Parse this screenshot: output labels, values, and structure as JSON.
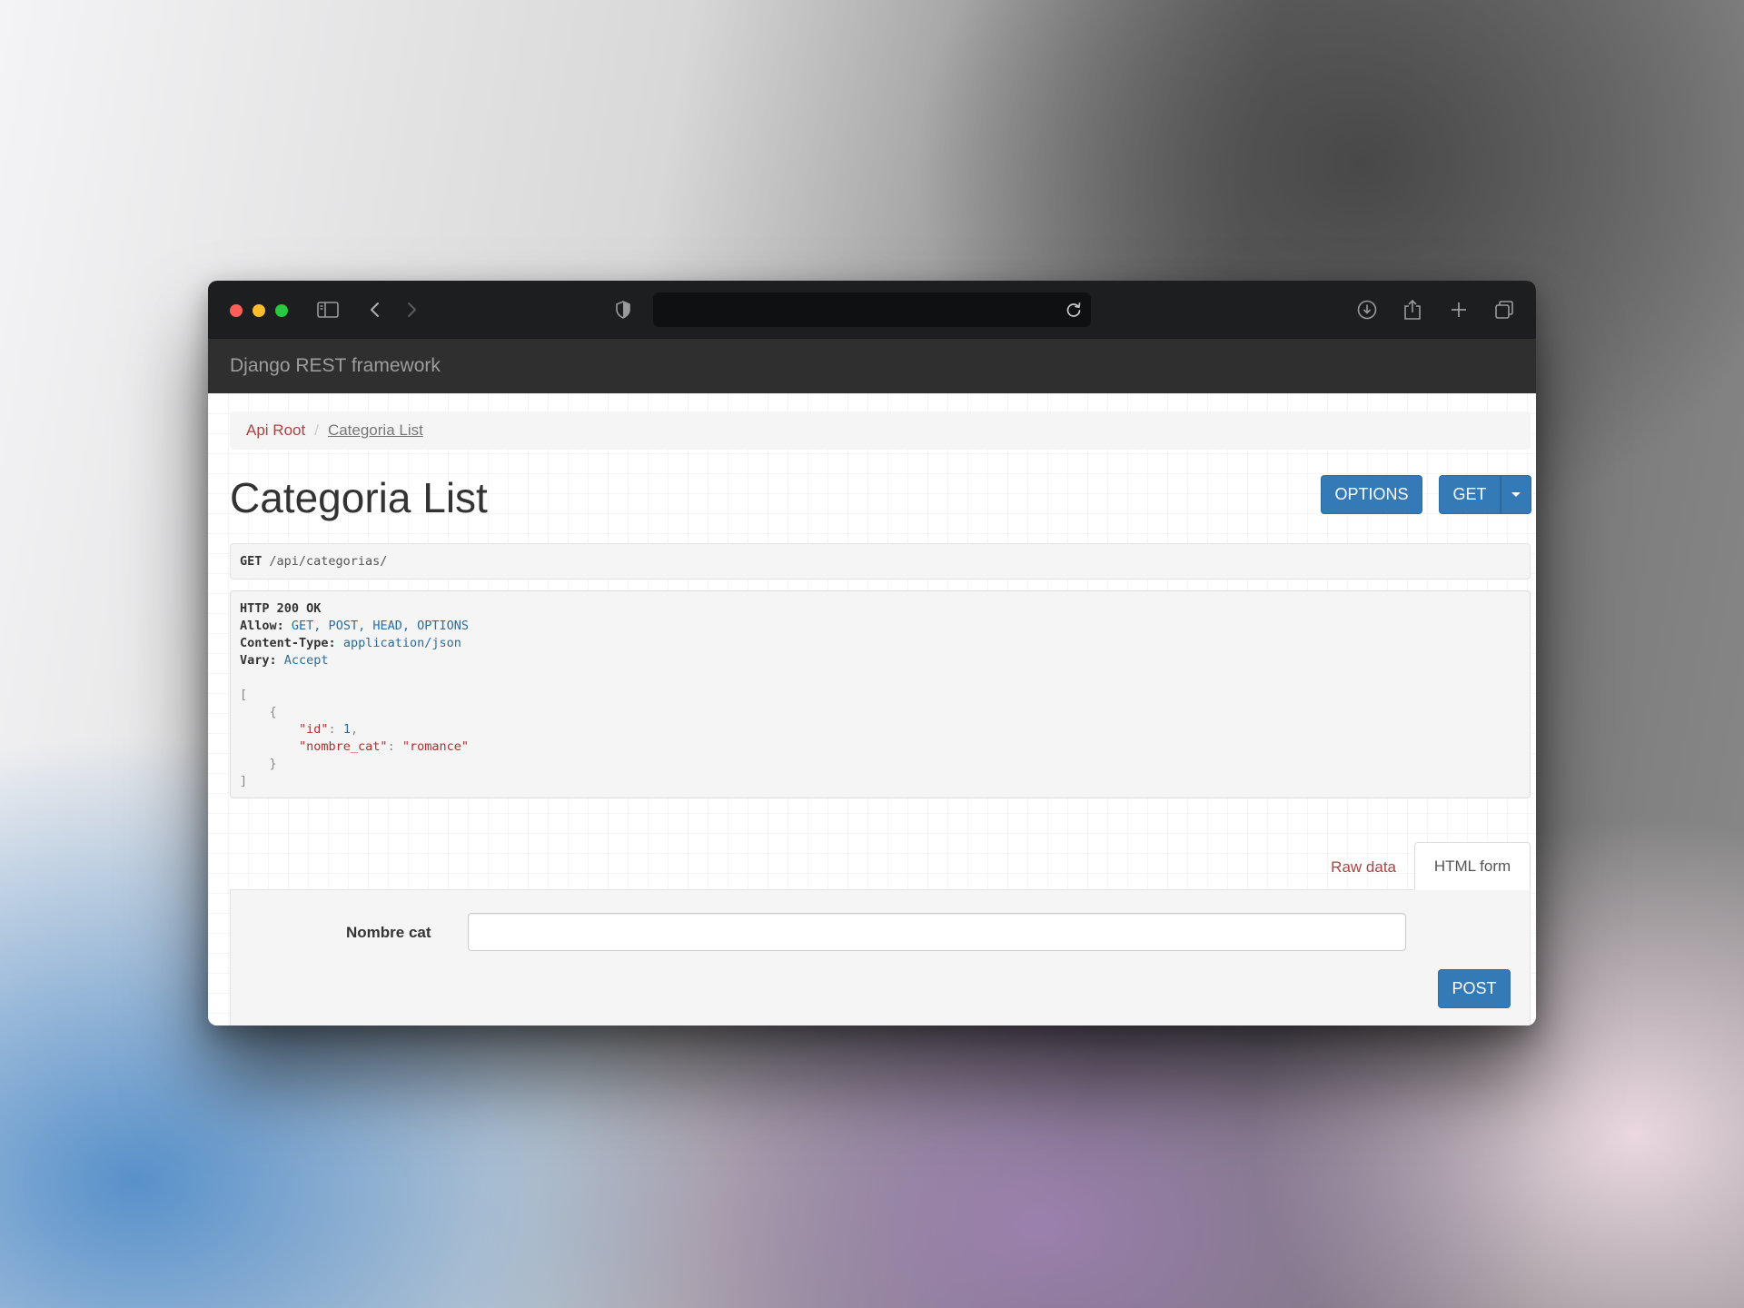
{
  "browser": {
    "url": "",
    "icons": {
      "sidebar": "sidebar-icon",
      "back": "chevron-left-icon",
      "forward": "chevron-right-icon",
      "shield": "shield-icon",
      "reload": "reload-icon",
      "download": "download-icon",
      "share": "share-icon",
      "new_tab": "plus-icon",
      "tabs": "tabs-overview-icon"
    }
  },
  "navbar": {
    "brand": "Django REST framework"
  },
  "breadcrumb": {
    "root": "Api Root",
    "separator": "/",
    "current": "Categoria List"
  },
  "page": {
    "title": "Categoria List"
  },
  "actions": {
    "options_label": "OPTIONS",
    "get_label": "GET"
  },
  "request": {
    "method": "GET",
    "path": "/api/categorias/"
  },
  "response": {
    "status": "HTTP 200 OK",
    "headers": [
      {
        "name": "Allow:",
        "value": "GET, POST, HEAD, OPTIONS"
      },
      {
        "name": "Content-Type:",
        "value": "application/json"
      },
      {
        "name": "Vary:",
        "value": "Accept"
      }
    ],
    "body": {
      "open_bracket": "[",
      "open_brace": "{",
      "fields": [
        {
          "key": "\"id\"",
          "value": "1",
          "type": "num",
          "trailing": ","
        },
        {
          "key": "\"nombre_cat\"",
          "value": "\"romance\"",
          "type": "str",
          "trailing": ""
        }
      ],
      "close_brace": "}",
      "close_bracket": "]"
    }
  },
  "tabs": {
    "raw": "Raw data",
    "html": "HTML form",
    "active": "html"
  },
  "form": {
    "field_label": "Nombre cat",
    "field_value": "",
    "field_placeholder": "",
    "submit_label": "POST"
  },
  "colors": {
    "primary": "#337ab7",
    "link": "#a94442",
    "navbar": "#2f2f2f",
    "titlebar": "#1d1e20"
  }
}
